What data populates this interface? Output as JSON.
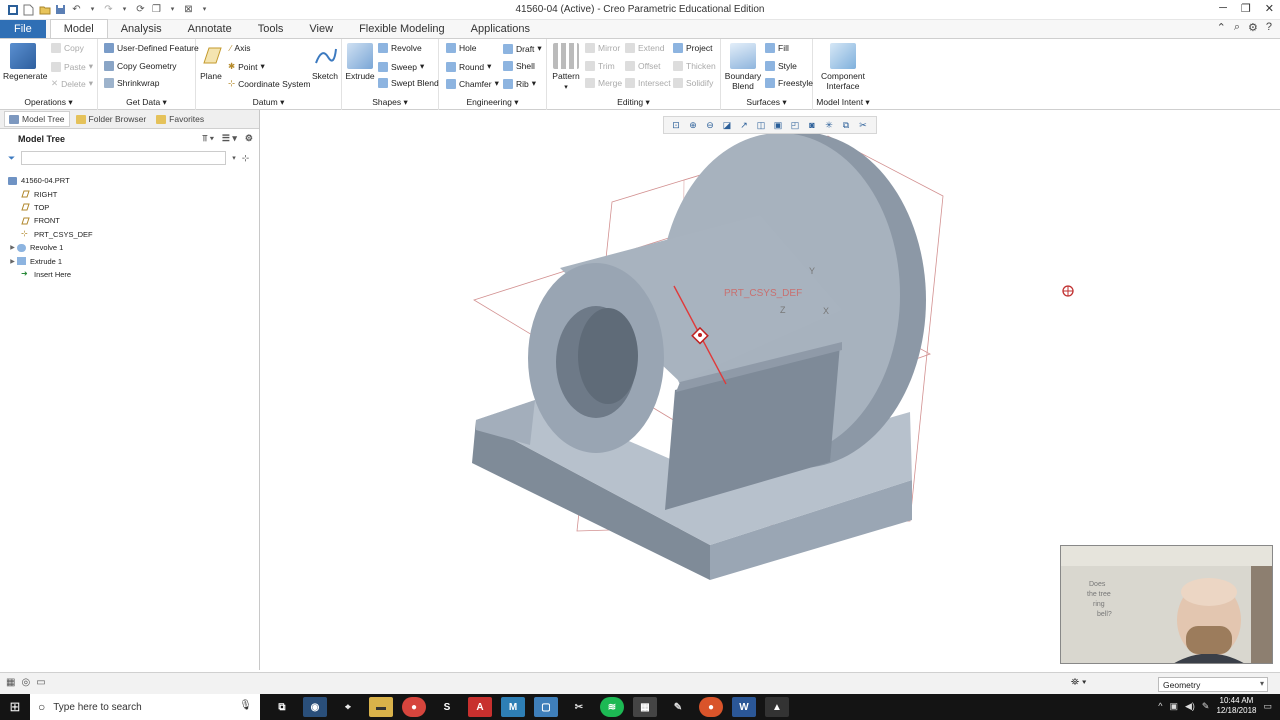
{
  "window": {
    "title": "41560-04 (Active) - Creo Parametric Educational Edition"
  },
  "tabs": [
    {
      "label": "File"
    },
    {
      "label": "Model"
    },
    {
      "label": "Analysis"
    },
    {
      "label": "Annotate"
    },
    {
      "label": "Tools"
    },
    {
      "label": "View"
    },
    {
      "label": "Flexible Modeling"
    },
    {
      "label": "Applications"
    }
  ],
  "ribbon": {
    "operations": {
      "label": "Operations",
      "regenerate": "Regenerate",
      "copy": "Copy",
      "paste": "Paste",
      "delete": "Delete"
    },
    "getdata": {
      "label": "Get Data",
      "udf": "User-Defined Feature",
      "copygeom": "Copy Geometry",
      "shrinkwrap": "Shrinkwrap"
    },
    "datum": {
      "label": "Datum",
      "plane": "Plane",
      "axis": "Axis",
      "point": "Point",
      "csys": "Coordinate System",
      "sketch": "Sketch"
    },
    "shapes": {
      "label": "Shapes",
      "extrude": "Extrude",
      "revolve": "Revolve",
      "sweep": "Sweep",
      "sweptblend": "Swept Blend"
    },
    "engineering": {
      "label": "Engineering",
      "hole": "Hole",
      "round": "Round",
      "chamfer": "Chamfer",
      "draft": "Draft",
      "shell": "Shell",
      "rib": "Rib"
    },
    "editing": {
      "label": "Editing",
      "pattern": "Pattern",
      "mirror": "Mirror",
      "trim": "Trim",
      "merge": "Merge",
      "extend": "Extend",
      "offset": "Offset",
      "intersect": "Intersect",
      "project": "Project",
      "thicken": "Thicken",
      "solidify": "Solidify"
    },
    "surfaces": {
      "label": "Surfaces",
      "boundary1": "Boundary",
      "boundary2": "Blend",
      "fill": "Fill",
      "style": "Style",
      "freestyle": "Freestyle"
    },
    "modelintent": {
      "label": "Model Intent",
      "ci1": "Component",
      "ci2": "Interface"
    }
  },
  "leftpanel": {
    "tabs": [
      {
        "label": "Model Tree"
      },
      {
        "label": "Folder Browser"
      },
      {
        "label": "Favorites"
      }
    ],
    "title": "Model Tree",
    "filter_placeholder": "",
    "tree": [
      {
        "label": "41560-04.PRT"
      },
      {
        "label": "RIGHT"
      },
      {
        "label": "TOP"
      },
      {
        "label": "FRONT"
      },
      {
        "label": "PRT_CSYS_DEF"
      },
      {
        "label": "Revolve 1"
      },
      {
        "label": "Extrude 1"
      },
      {
        "label": "Insert Here"
      }
    ]
  },
  "viewport": {
    "csys_label": "PRT_CSYS_DEF",
    "axis_x": "X",
    "axis_y": "Y",
    "axis_z": "Z"
  },
  "statusbar": {
    "filter_value": "Geometry"
  },
  "taskbar": {
    "search_placeholder": "Type here to search",
    "time": "10:44 AM",
    "date": "12/18/2018"
  },
  "webcam": {
    "board_text": [
      "Does",
      "the tree",
      "ring",
      "bell?"
    ]
  },
  "colors": {
    "accent": "#2f6fb5",
    "part": "#9aa6b4",
    "datum": "#d08c8c"
  }
}
